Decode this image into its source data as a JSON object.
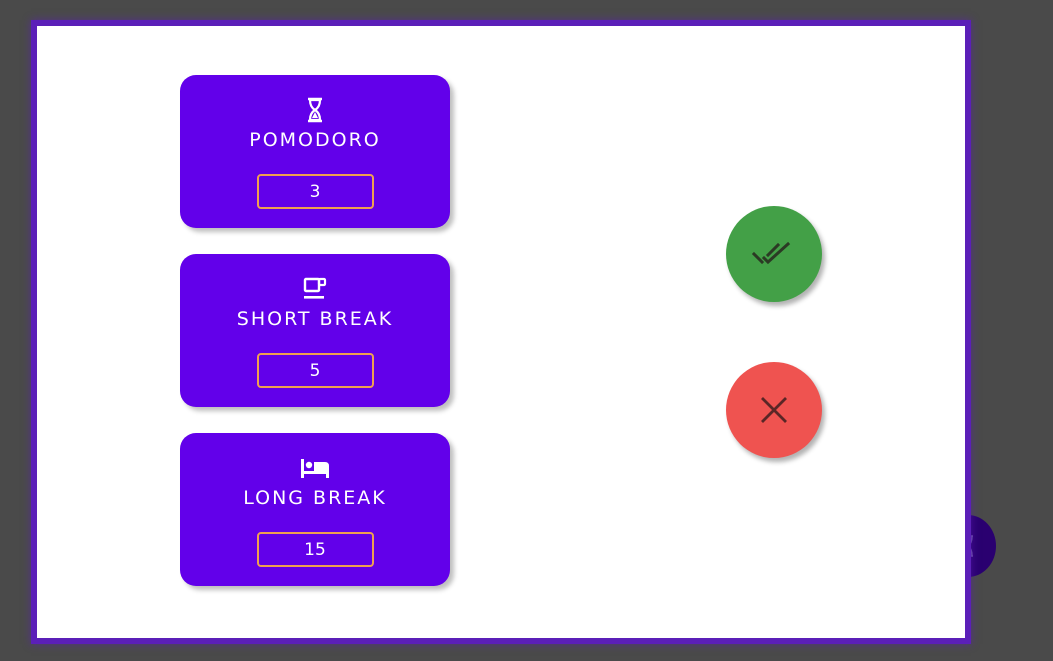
{
  "colors": {
    "backdrop": "#4a4a4a",
    "dialog_border": "#5b1fb8",
    "card_bg": "#6200ea",
    "input_border": "#f0a050",
    "confirm": "#43a047",
    "cancel": "#ef5350"
  },
  "settings": {
    "pomodoro": {
      "icon": "hourglass-icon",
      "label": "POMODORO",
      "value": "3"
    },
    "short_break": {
      "icon": "coffee-cup-icon",
      "label": "SHORT BREAK",
      "value": "5"
    },
    "long_break": {
      "icon": "bed-icon",
      "label": "LONG BREAK",
      "value": "15"
    }
  },
  "actions": {
    "confirm_icon": "double-check-icon",
    "cancel_icon": "close-icon"
  },
  "background": {
    "fab_icon": "hourglass-icon"
  }
}
